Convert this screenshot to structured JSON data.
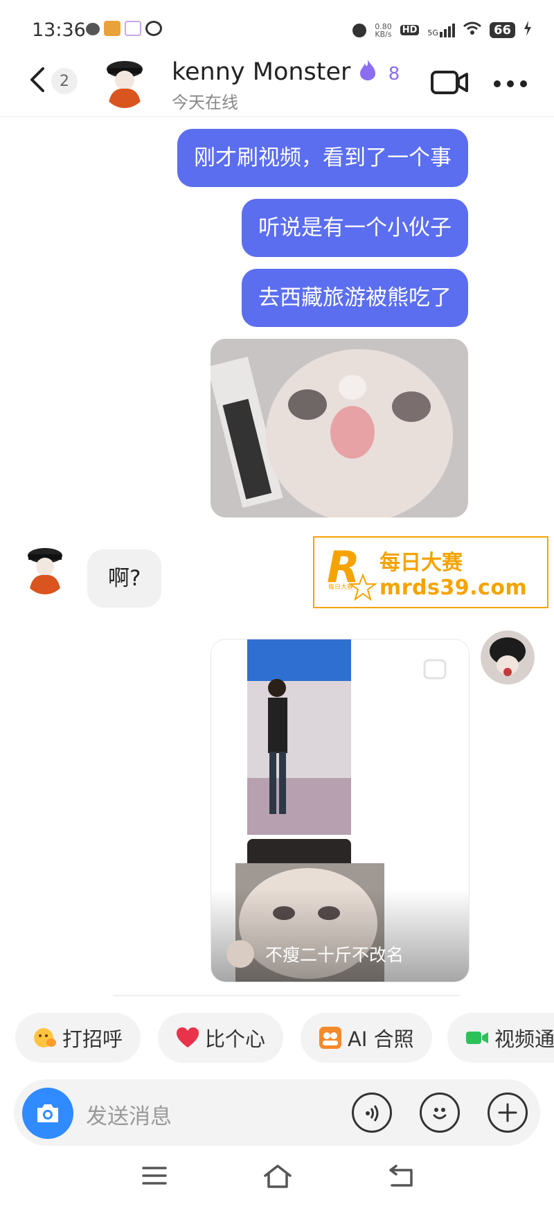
{
  "status_bar": {
    "time": "13:36",
    "net_speed": "0.80\nKB/s",
    "hd": "HD",
    "signal": "5G",
    "battery": "66"
  },
  "header": {
    "unread_count": "2",
    "contact_name": "kenny Monster",
    "flame_count": "8",
    "online_status": "今天在线"
  },
  "messages": [
    {
      "from": "me",
      "text": "刚才刷视频，看到了一个事"
    },
    {
      "from": "me",
      "text": "听说是有一个小伙子"
    },
    {
      "from": "me",
      "text": "去西藏旅游被熊吃了"
    },
    {
      "from": "them",
      "text": "啊?"
    }
  ],
  "video_card": {
    "caption": "不瘦二十斤不改名"
  },
  "watermark": {
    "brand": "每日大赛",
    "url": "mrds39.com",
    "logo_letter": "R",
    "logo_small": "每日大赛"
  },
  "quick_actions": [
    {
      "label": "打招呼",
      "icon": "wave-emoji-icon"
    },
    {
      "label": "比个心",
      "icon": "heart-icon"
    },
    {
      "label": "AI 合照",
      "icon": "ai-photo-icon"
    },
    {
      "label": "视频通",
      "icon": "video-call-icon"
    }
  ],
  "input": {
    "placeholder": "发送消息"
  },
  "colors": {
    "bubble_out": "#5b6ef0",
    "accent_blue": "#2f8bff",
    "flame": "#8a6df0",
    "watermark": "#f5a300"
  }
}
